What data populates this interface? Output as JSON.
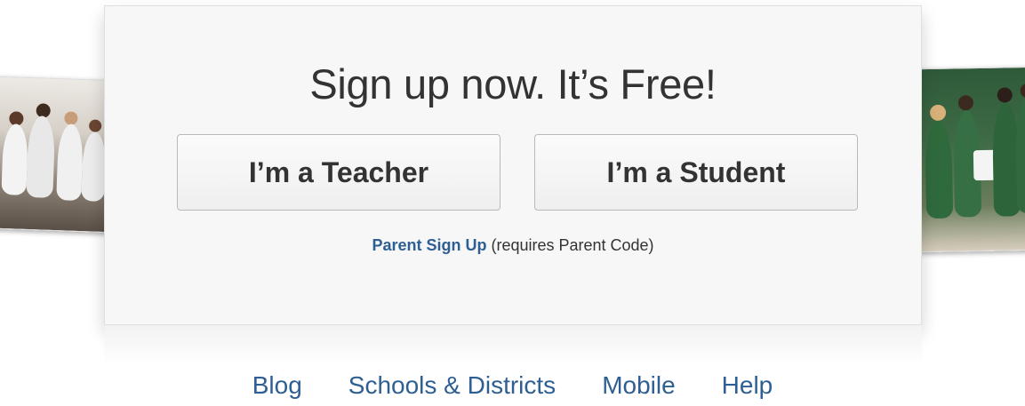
{
  "signup": {
    "headline": "Sign up now. It’s Free!",
    "teacher_button": "I’m a Teacher",
    "student_button": "I’m a Student",
    "parent_link": "Parent Sign Up",
    "parent_note": "(requires Parent Code)"
  },
  "footer": {
    "links": [
      "Blog",
      "Schools & Districts",
      "Mobile",
      "Help"
    ]
  },
  "colors": {
    "link": "#2e5f93",
    "text": "#333333",
    "card_background": "#f7f7f7"
  }
}
